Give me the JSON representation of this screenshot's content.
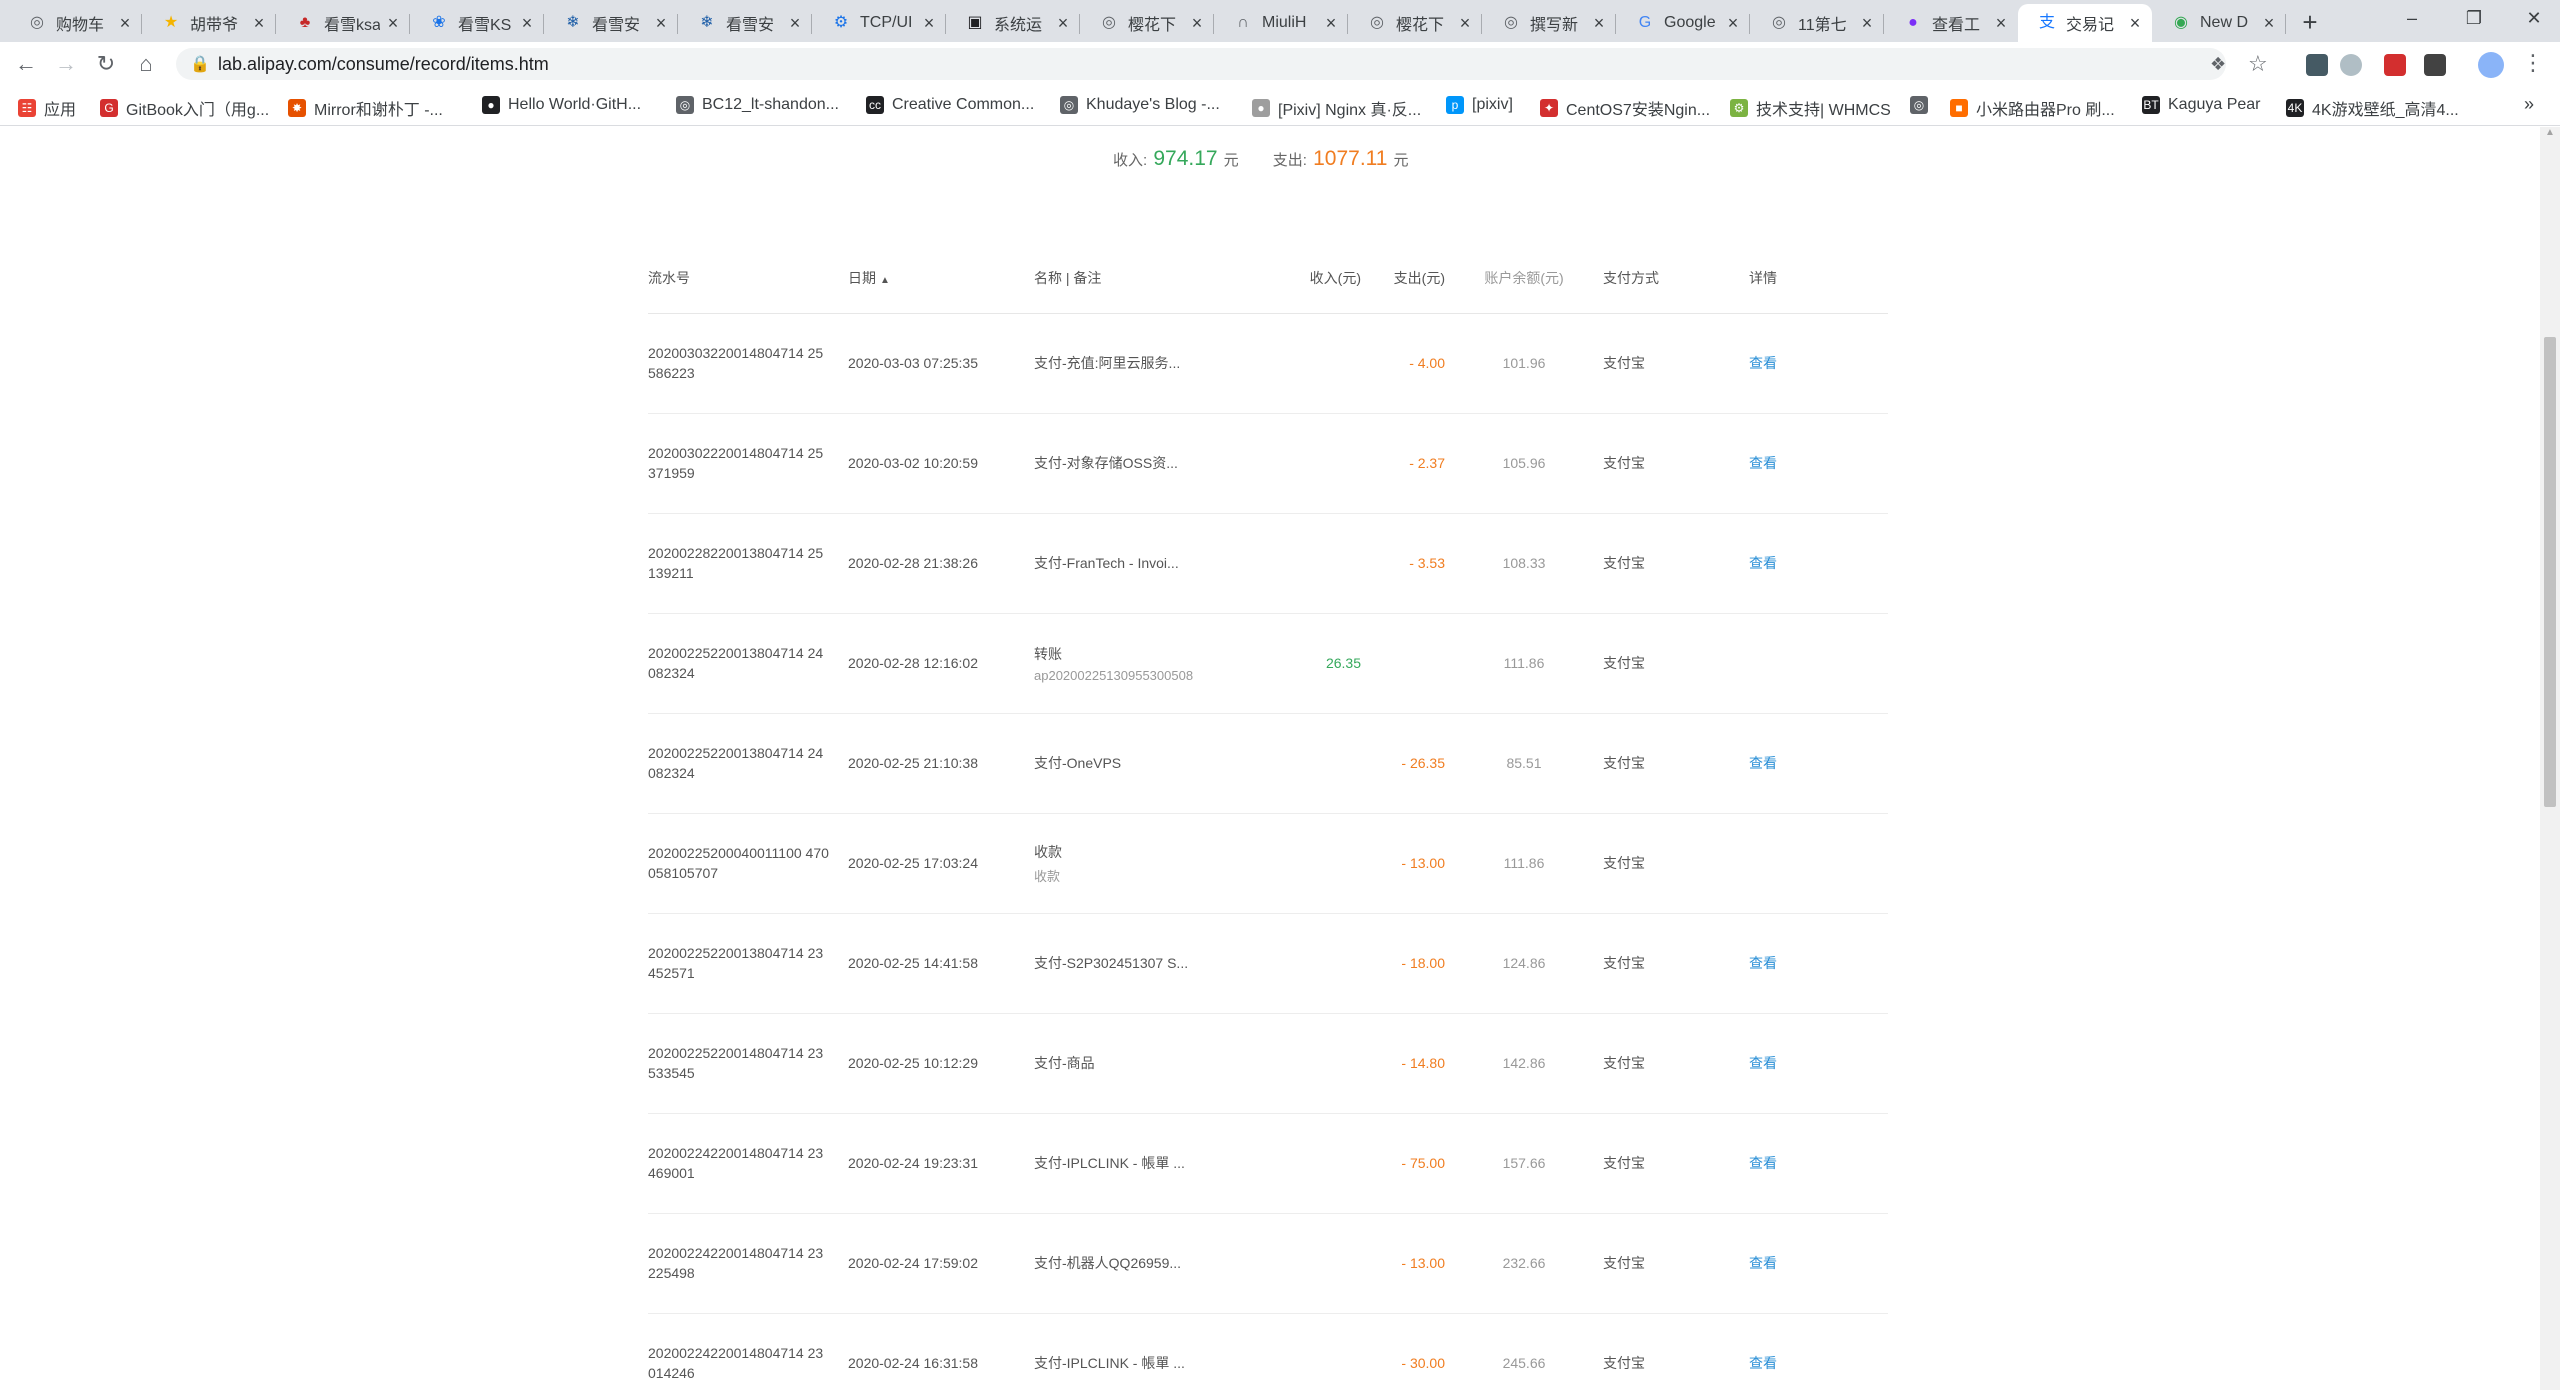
{
  "browser": {
    "tabs": [
      {
        "label": "购物车",
        "icon": "globe-icon",
        "color": "#5f6368"
      },
      {
        "label": "胡带爷",
        "icon": "star-icon",
        "color": "#f4b400"
      },
      {
        "label": "看雪ksa",
        "icon": "maple-icon",
        "color": "#c62828"
      },
      {
        "label": "看雪KS",
        "icon": "paw-icon",
        "color": "#1a73e8"
      },
      {
        "label": "看雪安",
        "icon": "snowflake-icon",
        "color": "#1f5fa8"
      },
      {
        "label": "看雪安",
        "icon": "snowflake-icon",
        "color": "#1f5fa8"
      },
      {
        "label": "TCP/UI",
        "icon": "gear-icon",
        "color": "#1a73e8"
      },
      {
        "label": "系统运",
        "icon": "doc-icon",
        "color": "#202124"
      },
      {
        "label": "樱花下",
        "icon": "globe-icon",
        "color": "#5f6368"
      },
      {
        "label": "MiuliH",
        "icon": "arch-icon",
        "color": "#5f6368"
      },
      {
        "label": "樱花下",
        "icon": "globe-icon",
        "color": "#5f6368"
      },
      {
        "label": "撰写新",
        "icon": "globe-icon",
        "color": "#5f6368"
      },
      {
        "label": "Google",
        "icon": "google-icon",
        "color": "#4285f4"
      },
      {
        "label": "11第七",
        "icon": "globe-icon",
        "color": "#5f6368"
      },
      {
        "label": "查看工",
        "icon": "purple-icon",
        "color": "#7b2ff7"
      },
      {
        "label": "交易记",
        "icon": "alipay-icon",
        "color": "#1677ff"
      },
      {
        "label": "New D",
        "icon": "chrome-icon",
        "color": "#34a853"
      }
    ],
    "active_tab": 15,
    "url": "lab.alipay.com/consume/record/items.htm",
    "bookmarks": [
      {
        "label": "应用",
        "icon": "apps-icon",
        "color": "#ea4335"
      },
      {
        "label": "GitBook入门（用g...",
        "icon": "gitbook-icon",
        "color": "#d32f2f"
      },
      {
        "label": "Mirror和谢朴丁 -...",
        "icon": "fox-icon",
        "color": "#e65100"
      },
      {
        "label": "Hello World·GitH...",
        "icon": "github-icon",
        "color": "#202124"
      },
      {
        "label": "BC12_lt-shandon...",
        "icon": "globe-icon",
        "color": "#5f6368"
      },
      {
        "label": "Creative Common...",
        "icon": "cc-icon",
        "color": "#202124"
      },
      {
        "label": "Khudaye's Blog -...",
        "icon": "globe-icon",
        "color": "#5f6368"
      },
      {
        "label": "[Pixiv] Nginx 真·反...",
        "icon": "avatar-icon",
        "color": "#9e9e9e"
      },
      {
        "label": "[pixiv]",
        "icon": "pixiv-icon",
        "color": "#0096fa"
      },
      {
        "label": "CentOS7安装Ngin...",
        "icon": "centos-icon",
        "color": "#d32f2f"
      },
      {
        "label": "技术支持| WHMCS",
        "icon": "whmcs-icon",
        "color": "#7cb342"
      },
      {
        "label": "",
        "icon": "globe-icon",
        "color": "#5f6368"
      },
      {
        "label": "小米路由器Pro 刷...",
        "icon": "mi-icon",
        "color": "#ff6d00"
      },
      {
        "label": "Kaguya Pear",
        "icon": "bt-icon",
        "color": "#202124"
      },
      {
        "label": "4K游戏壁纸_高清4...",
        "icon": "4k-icon",
        "color": "#202124"
      }
    ]
  },
  "summary": {
    "income_label": "收入:",
    "income_value": "974.17",
    "income_unit": "元",
    "expense_label": "支出:",
    "expense_value": "1077.11",
    "expense_unit": "元"
  },
  "table": {
    "headers": {
      "serial": "流水号",
      "date": "日期",
      "name": "名称 | 备注",
      "income": "收入(元)",
      "expense": "支出(元)",
      "balance": "账户余额(元)",
      "payment": "支付方式",
      "detail": "详情"
    },
    "rows": [
      {
        "serial": "20200303220014804714 25586223",
        "date": "2020-03-03 07:25:35",
        "name": "支付-充值:阿里云服务...",
        "memo": "",
        "income": "",
        "expense": "- 4.00",
        "balance": "101.96",
        "payment": "支付宝",
        "detail": "查看"
      },
      {
        "serial": "20200302220014804714 25371959",
        "date": "2020-03-02 10:20:59",
        "name": "支付-对象存储OSS资...",
        "memo": "",
        "income": "",
        "expense": "- 2.37",
        "balance": "105.96",
        "payment": "支付宝",
        "detail": "查看"
      },
      {
        "serial": "20200228220013804714 25139211",
        "date": "2020-02-28 21:38:26",
        "name": "支付-FranTech - Invoi...",
        "memo": "",
        "income": "",
        "expense": "- 3.53",
        "balance": "108.33",
        "payment": "支付宝",
        "detail": "查看"
      },
      {
        "serial": "20200225220013804714 24082324",
        "date": "2020-02-28 12:16:02",
        "name": "转账",
        "memo": "ap20200225130955300508",
        "income": "26.35",
        "expense": "",
        "balance": "111.86",
        "payment": "支付宝",
        "detail": ""
      },
      {
        "serial": "20200225220013804714 24082324",
        "date": "2020-02-25 21:10:38",
        "name": "支付-OneVPS",
        "memo": "",
        "income": "",
        "expense": "- 26.35",
        "balance": "85.51",
        "payment": "支付宝",
        "detail": "查看"
      },
      {
        "serial": "20200225200040011100 470058105707",
        "date": "2020-02-25 17:03:24",
        "name": "收款",
        "memo": "收款",
        "income": "",
        "expense": "- 13.00",
        "balance": "111.86",
        "payment": "支付宝",
        "detail": ""
      },
      {
        "serial": "20200225220013804714 23452571",
        "date": "2020-02-25 14:41:58",
        "name": "支付-S2P302451307 S...",
        "memo": "",
        "income": "",
        "expense": "- 18.00",
        "balance": "124.86",
        "payment": "支付宝",
        "detail": "查看"
      },
      {
        "serial": "20200225220014804714 23533545",
        "date": "2020-02-25 10:12:29",
        "name": "支付-商品",
        "memo": "",
        "income": "",
        "expense": "- 14.80",
        "balance": "142.86",
        "payment": "支付宝",
        "detail": "查看"
      },
      {
        "serial": "20200224220014804714 23469001",
        "date": "2020-02-24 19:23:31",
        "name": "支付-IPLCLINK - 帳單 ...",
        "memo": "",
        "income": "",
        "expense": "- 75.00",
        "balance": "157.66",
        "payment": "支付宝",
        "detail": "查看"
      },
      {
        "serial": "20200224220014804714 23225498",
        "date": "2020-02-24 17:59:02",
        "name": "支付-机器人QQ26959...",
        "memo": "",
        "income": "",
        "expense": "- 13.00",
        "balance": "232.66",
        "payment": "支付宝",
        "detail": "查看"
      },
      {
        "serial": "20200224220014804714 23014246",
        "date": "2020-02-24 16:31:58",
        "name": "支付-IPLCLINK - 帳單 ...",
        "memo": "",
        "income": "",
        "expense": "- 30.00",
        "balance": "245.66",
        "payment": "支付宝",
        "detail": "查看"
      }
    ]
  },
  "colors": {
    "income": "#35a85b",
    "expense": "#f07d21",
    "link": "#2a8fd6"
  }
}
